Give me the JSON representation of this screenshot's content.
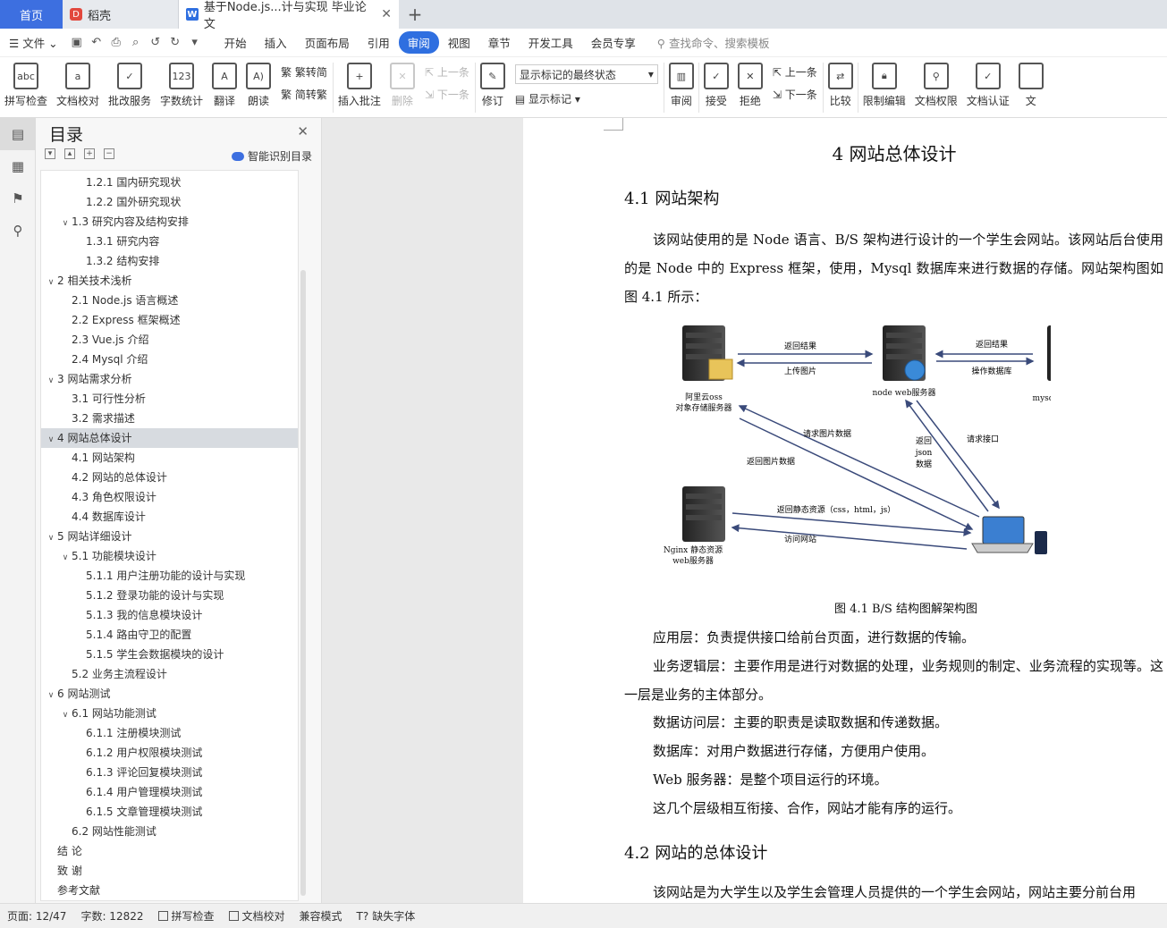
{
  "tabs": {
    "home": "首页",
    "daoke": "稻壳",
    "doc": "基于Node.js...计与实现 毕业论文",
    "plus": "+"
  },
  "menu": {
    "file": "文件",
    "items": [
      "开始",
      "插入",
      "页面布局",
      "引用",
      "审阅",
      "视图",
      "章节",
      "开发工具",
      "会员专享"
    ],
    "active_index": 4,
    "search": "查找命令、搜索模板"
  },
  "ribbon": {
    "spell": "拼写检查",
    "proof": "文档校对",
    "batch": "批改服务",
    "count": "字数统计",
    "translate": "翻译",
    "read": "朗读",
    "trad": "繁转简",
    "simp": "简转繁",
    "insert_comment": "插入批注",
    "delete": "删除",
    "prev_comment": "上一条",
    "next_comment": "下一条",
    "revise": "修订",
    "markup_dropdown": "显示标记的最终状态",
    "show_markup": "显示标记",
    "review": "审阅",
    "accept": "接受",
    "reject": "拒绝",
    "prev": "上一条",
    "next": "下一条",
    "compare": "比较",
    "restrict": "限制编辑",
    "rights": "文档权限",
    "certify": "文档认证",
    "more": "文"
  },
  "toc": {
    "title": "目录",
    "smart": "智能识别目录",
    "items": [
      {
        "text": "1.2.1 国内研究现状",
        "level": 3,
        "arrow": ""
      },
      {
        "text": "1.2.2 国外研究现状",
        "level": 3,
        "arrow": ""
      },
      {
        "text": "1.3  研究内容及结构安排",
        "level": 2,
        "arrow": "v"
      },
      {
        "text": "1.3.1  研究内容",
        "level": 3,
        "arrow": ""
      },
      {
        "text": "1.3.2  结构安排",
        "level": 3,
        "arrow": ""
      },
      {
        "text": "2 相关技术浅析",
        "level": 1,
        "arrow": "v"
      },
      {
        "text": "2.1 Node.js 语言概述",
        "level": 2,
        "arrow": ""
      },
      {
        "text": "2.2 Express 框架概述",
        "level": 2,
        "arrow": ""
      },
      {
        "text": "2.3 Vue.js 介绍",
        "level": 2,
        "arrow": ""
      },
      {
        "text": "2.4 Mysql 介绍",
        "level": 2,
        "arrow": ""
      },
      {
        "text": "3 网站需求分析",
        "level": 1,
        "arrow": "v"
      },
      {
        "text": "3.1 可行性分析",
        "level": 2,
        "arrow": ""
      },
      {
        "text": "3.2 需求描述",
        "level": 2,
        "arrow": ""
      },
      {
        "text": "4 网站总体设计",
        "level": 1,
        "arrow": "v",
        "selected": true
      },
      {
        "text": "4.1  网站架构",
        "level": 2,
        "arrow": ""
      },
      {
        "text": "4.2  网站的总体设计",
        "level": 2,
        "arrow": ""
      },
      {
        "text": "4.3  角色权限设计",
        "level": 2,
        "arrow": ""
      },
      {
        "text": "4.4  数据库设计",
        "level": 2,
        "arrow": ""
      },
      {
        "text": "5 网站详细设计",
        "level": 1,
        "arrow": "v"
      },
      {
        "text": "5.1  功能模块设计",
        "level": 2,
        "arrow": "v"
      },
      {
        "text": "5.1.1  用户注册功能的设计与实现",
        "level": 3,
        "arrow": ""
      },
      {
        "text": "5.1.2  登录功能的设计与实现",
        "level": 3,
        "arrow": ""
      },
      {
        "text": "5.1.3  我的信息模块设计",
        "level": 3,
        "arrow": ""
      },
      {
        "text": "5.1.4  路由守卫的配置",
        "level": 3,
        "arrow": ""
      },
      {
        "text": "5.1.5  学生会数据模块的设计",
        "level": 3,
        "arrow": ""
      },
      {
        "text": "5.2 业务主流程设计",
        "level": 2,
        "arrow": ""
      },
      {
        "text": "6 网站测试",
        "level": 1,
        "arrow": "v"
      },
      {
        "text": "6.1  网站功能测试",
        "level": 2,
        "arrow": "v"
      },
      {
        "text": "6.1.1  注册模块测试",
        "level": 3,
        "arrow": ""
      },
      {
        "text": "6.1.2  用户权限模块测试",
        "level": 3,
        "arrow": ""
      },
      {
        "text": "6.1.3  评论回复模块测试",
        "level": 3,
        "arrow": ""
      },
      {
        "text": "6.1.4  用户管理模块测试",
        "level": 3,
        "arrow": ""
      },
      {
        "text": "6.1.5  文章管理模块测试",
        "level": 3,
        "arrow": ""
      },
      {
        "text": "6.2  网站性能测试",
        "level": 2,
        "arrow": ""
      },
      {
        "text": "结    论",
        "level": 1,
        "arrow": ""
      },
      {
        "text": "致    谢",
        "level": 1,
        "arrow": ""
      },
      {
        "text": "参考文献",
        "level": 1,
        "arrow": ""
      }
    ]
  },
  "doc": {
    "chapter": "4 网站总体设计",
    "s41": "4.1  网站架构",
    "p1": "该网站使用的是 Node 语言、B/S 架构进行设计的一个学生会网站。该网站后台使用的是 Node 中的 Express 框架，使用，Mysql 数据库来进行数据的存储。网站架构图如图 4.1 所示：",
    "figure": {
      "oss": "阿里云oss",
      "oss2": "对象存储服务器",
      "node": "node web服务器",
      "mysql": "mysql数据库服务器",
      "nginx": "Nginx 静态资源",
      "nginx2": "web服务器",
      "return_result1": "返回结果",
      "upload": "上传图片",
      "return_result2": "返回结果",
      "op_db": "操作数据库",
      "req_img": "请求图片数据",
      "ret_img": "返回图片数据",
      "ret_json1": "返回",
      "ret_json2": "json",
      "ret_json3": "数据",
      "req_api": "请求接口",
      "ret_static": "返回静态资源（css，html，js）",
      "visit": "访问网站"
    },
    "caption": "图 4.1 B/S 结构图解架构图",
    "p2": "应用层：负责提供接口给前台页面，进行数据的传输。",
    "p3": "业务逻辑层：主要作用是进行对数据的处理，业务规则的制定、业务流程的实现等。这一层是业务的主体部分。",
    "p4": "数据访问层：主要的职责是读取数据和传递数据。",
    "p5": "数据库：对用户数据进行存储，方便用户使用。",
    "p6": "Web 服务器：是整个项目运行的环境。",
    "p7": "这几个层级相互衔接、合作，网站才能有序的运行。",
    "s42": "4.2  网站的总体设计",
    "p8": "该网站是为大学生以及学生会管理人员提供的一个学生会网站，网站主要分前台用"
  },
  "status": {
    "page": "页面: 12/47",
    "words": "字数: 12822",
    "spell": "拼写检查",
    "proof": "文档校对",
    "compat": "兼容模式",
    "missing_font": "缺失字体"
  }
}
